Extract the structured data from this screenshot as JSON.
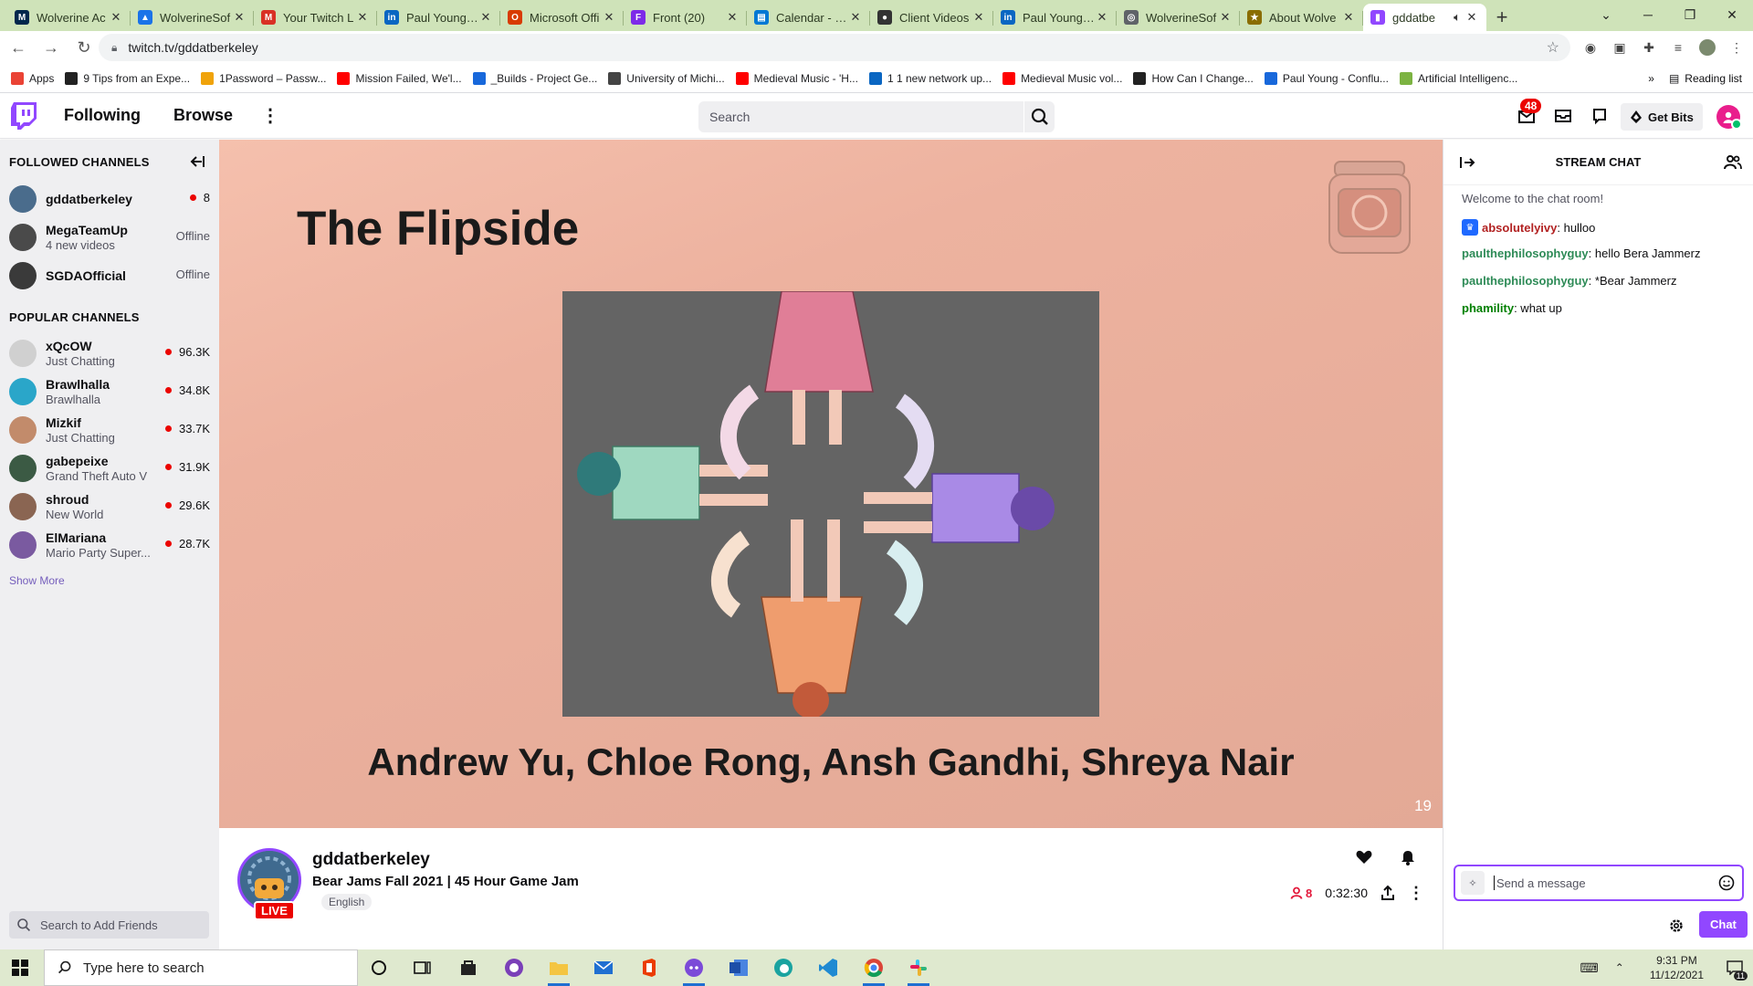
{
  "browser": {
    "tabs": [
      {
        "title": "Wolverine Ac",
        "color": "#00274c",
        "glyph": "M"
      },
      {
        "title": "WolverineSof",
        "color": "#1a73e8",
        "glyph": "▲"
      },
      {
        "title": "Your Twitch L",
        "color": "#d93025",
        "glyph": "M"
      },
      {
        "title": "Paul Young | L",
        "color": "#0a66c2",
        "glyph": "in"
      },
      {
        "title": "Microsoft Offi",
        "color": "#d83b01",
        "glyph": "O"
      },
      {
        "title": "Front (20)",
        "color": "#7d2ae8",
        "glyph": "F"
      },
      {
        "title": "Calendar - Pa",
        "color": "#0078d4",
        "glyph": "▤"
      },
      {
        "title": "Client Videos",
        "color": "#333333",
        "glyph": "●"
      },
      {
        "title": "Paul Young | L",
        "color": "#0a66c2",
        "glyph": "in"
      },
      {
        "title": "WolverineSof",
        "color": "#5f6368",
        "glyph": "◎"
      },
      {
        "title": "About Wolve",
        "color": "#8a6d00",
        "glyph": "★"
      },
      {
        "title": "gddatbe",
        "color": "#9147ff",
        "glyph": "▮",
        "active": true
      }
    ],
    "url": "twitch.tv/gddatberkeley",
    "bookmarks": [
      {
        "label": "Apps",
        "color": "#ea4335"
      },
      {
        "label": "9 Tips from an Expe...",
        "color": "#222222"
      },
      {
        "label": "1Password – Passw...",
        "color": "#f0a30a"
      },
      {
        "label": "Mission Failed, We'l...",
        "color": "#ff0000"
      },
      {
        "label": "_Builds - Project Ge...",
        "color": "#1868db"
      },
      {
        "label": "University of Michi...",
        "color": "#444444"
      },
      {
        "label": "Medieval Music - 'H...",
        "color": "#ff0000"
      },
      {
        "label": "1 1 new network up...",
        "color": "#0a66c2"
      },
      {
        "label": "Medieval Music vol...",
        "color": "#ff0000"
      },
      {
        "label": "How Can I Change...",
        "color": "#222222"
      },
      {
        "label": "Paul Young - Conflu...",
        "color": "#1868db"
      },
      {
        "label": "Artificial Intelligenc...",
        "color": "#7cb342"
      }
    ],
    "reading_list": "Reading list"
  },
  "twitch": {
    "nav": {
      "following": "Following",
      "browse": "Browse",
      "search_placeholder": "Search",
      "notifications": "48",
      "get_bits": "Get Bits"
    },
    "sidebar": {
      "followed_header": "FOLLOWED CHANNELS",
      "followed": [
        {
          "name": "gddatberkeley",
          "sub": "",
          "status": "8",
          "live": true,
          "avatar": "#4a6c8c"
        },
        {
          "name": "MegaTeamUp",
          "sub": "4 new videos",
          "status": "Offline",
          "live": false,
          "avatar": "#4a4a4a"
        },
        {
          "name": "SGDAOfficial",
          "sub": "",
          "status": "Offline",
          "live": false,
          "avatar": "#3a3a3a"
        }
      ],
      "popular_header": "POPULAR CHANNELS",
      "popular": [
        {
          "name": "xQcOW",
          "sub": "Just Chatting",
          "status": "96.3K",
          "avatar": "#d0d0d0"
        },
        {
          "name": "Brawlhalla",
          "sub": "Brawlhalla",
          "status": "34.8K",
          "avatar": "#2aa6c9"
        },
        {
          "name": "Mizkif",
          "sub": "Just Chatting",
          "status": "33.7K",
          "avatar": "#c28b6b"
        },
        {
          "name": "gabepeixe",
          "sub": "Grand Theft Auto V",
          "status": "31.9K",
          "avatar": "#3b5a44"
        },
        {
          "name": "shroud",
          "sub": "New World",
          "status": "29.6K",
          "avatar": "#8a6552"
        },
        {
          "name": "ElMariana",
          "sub": "Mario Party Super...",
          "status": "28.7K",
          "avatar": "#7a5aa0"
        }
      ],
      "show_more": "Show More",
      "friends_placeholder": "Search to Add Friends"
    },
    "video": {
      "slide_title": "The Flipside",
      "credits": "Andrew Yu, Chloe Rong, Ansh Gandhi, Shreya Nair",
      "page_number": "19"
    },
    "stream": {
      "channel": "gddatberkeley",
      "live_label": "LIVE",
      "title": "Bear Jams Fall 2021 | 45 Hour Game Jam",
      "tag": "English",
      "viewers": "8",
      "uptime": "0:32:30"
    },
    "chat": {
      "header": "STREAM CHAT",
      "welcome": "Welcome to the chat room!",
      "messages": [
        {
          "user": "absolutelyivy",
          "text": ": hulloo",
          "color": "#b22222",
          "badge": true
        },
        {
          "user": "paulthephilosophyguy",
          "text": ": hello Bera Jammerz",
          "color": "#2e8b57"
        },
        {
          "user": "paulthephilosophyguy",
          "text": ": *Bear Jammerz",
          "color": "#2e8b57"
        },
        {
          "user": "phamility",
          "text": ": what up",
          "color": "#008000"
        }
      ],
      "input_placeholder": "Send a message",
      "chat_button": "Chat"
    }
  },
  "taskbar": {
    "search_placeholder": "Type here to search",
    "time": "9:31 PM",
    "date": "11/12/2021",
    "notification_count": "11"
  }
}
